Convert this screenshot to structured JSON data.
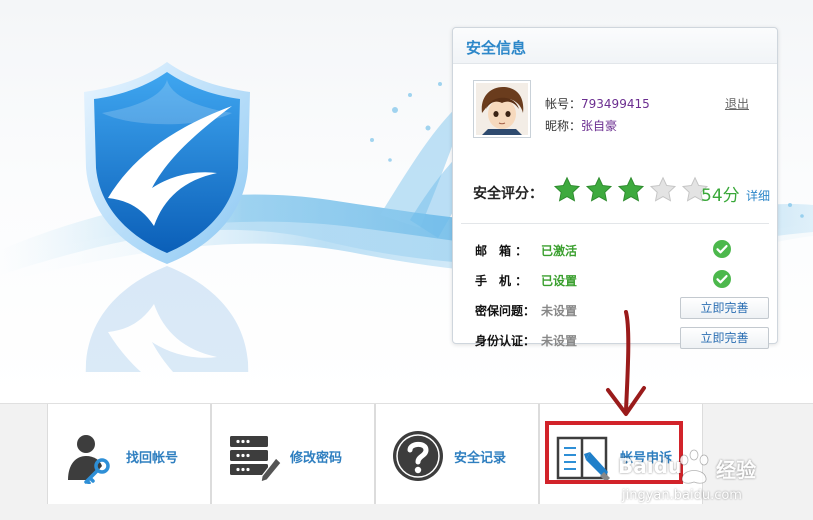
{
  "panel": {
    "title": "安全信息",
    "account_label": "帐号：",
    "account_value": "793499415",
    "nickname_label": "昵称：",
    "nickname_value": "张自豪",
    "logout_label": "退出",
    "score_label": "安全评分：",
    "score_stars_filled": 3,
    "score_stars_total": 5,
    "score_value": "54分",
    "detail_label": "详细",
    "items": [
      {
        "label": "邮　箱 ：",
        "status": "已激活",
        "done": true
      },
      {
        "label": "手　机 ：",
        "status": "已设置",
        "done": true
      },
      {
        "label": "密保问题：",
        "status": "未设置",
        "done": false,
        "action": "立即完善"
      },
      {
        "label": "身份认证：",
        "status": "未设置",
        "done": false,
        "action": "立即完善"
      }
    ]
  },
  "toolbar": {
    "items": [
      {
        "label": "找回帐号",
        "icon": "user-key-icon"
      },
      {
        "label": "修改密码",
        "icon": "password-edit-icon"
      },
      {
        "label": "安全记录",
        "icon": "question-icon"
      },
      {
        "label": "帐号申诉",
        "icon": "appeal-book-icon"
      }
    ]
  },
  "watermark": {
    "brand": "Baidu",
    "brand_cn": "经验",
    "url": "jingyan.baidu.com"
  },
  "colors": {
    "accent_blue": "#2c87c9",
    "ok_green": "#3a9f2e",
    "star_green": "#3aa83a",
    "annotation_red": "#d2232a",
    "shield_blue": "#1a7fd4"
  }
}
